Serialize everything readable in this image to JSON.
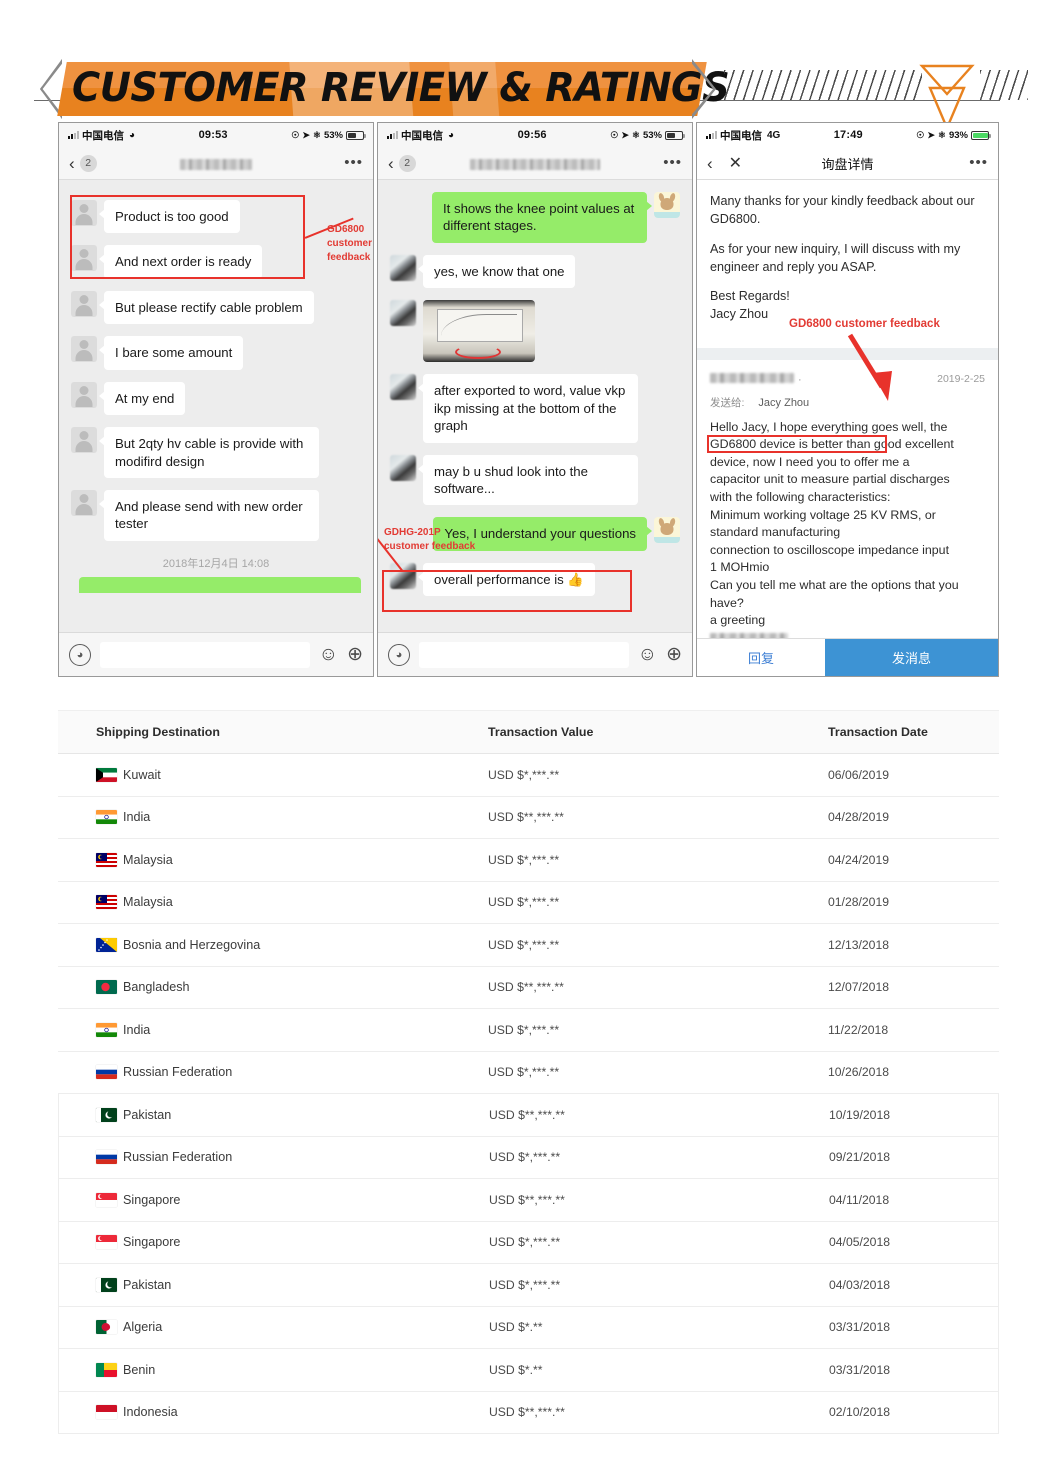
{
  "header": {
    "title": "CUSTOMER REVIEW & RATINGS",
    "accent_color": "#e8821f"
  },
  "phones": [
    {
      "name": "phone-1",
      "status": {
        "carrier": "中国电信",
        "network": "",
        "wifi": "wifi-icon",
        "time": "09:53",
        "battery": "53%"
      },
      "nav": {
        "back": "‹",
        "badge": "2",
        "title_blurred": true,
        "more": "•••"
      },
      "annotation": {
        "label": "GD6800\ncustomer\nfeedback",
        "label_lines": [
          "GD6800",
          "customer",
          "feedback"
        ]
      },
      "messages": [
        {
          "side": "left",
          "type": "text",
          "text": "Product is too good",
          "boxed": true
        },
        {
          "side": "left",
          "type": "text",
          "text": "And next order is ready",
          "boxed": true
        },
        {
          "side": "left",
          "type": "text",
          "text": "But please rectify cable problem"
        },
        {
          "side": "left",
          "type": "text",
          "text": "I bare some amount"
        },
        {
          "side": "left",
          "type": "text",
          "text": "At my end"
        },
        {
          "side": "left",
          "type": "text",
          "text": "But 2qty hv cable is provide with modifird design"
        },
        {
          "side": "left",
          "type": "text",
          "text": "And please send with new order tester"
        }
      ],
      "timestamp": "2018年12月4日 14:08",
      "input": {
        "voice_icon": "voice-icon",
        "placeholder": "",
        "value": "",
        "emoji_icon": "emoji-icon",
        "plus_icon": "plus-icon"
      }
    },
    {
      "name": "phone-2",
      "status": {
        "carrier": "中国电信",
        "network": "",
        "wifi": "wifi-icon",
        "time": "09:56",
        "battery": "53%"
      },
      "nav": {
        "back": "‹",
        "badge": "2",
        "title_blurred": true,
        "more": "•••"
      },
      "annotation": {
        "label_lines": [
          "GDHG-201P",
          "customer feedback"
        ]
      },
      "messages": [
        {
          "side": "right",
          "type": "text",
          "text": "It shows the knee point values at different stages."
        },
        {
          "side": "left",
          "type": "text",
          "text": "yes, we know that one"
        },
        {
          "side": "left",
          "type": "image",
          "text": ""
        },
        {
          "side": "left",
          "type": "text",
          "text": "after exported to word, value vkp ikp missing at the bottom of the graph"
        },
        {
          "side": "left",
          "type": "text",
          "text": "may b u shud look into the software..."
        },
        {
          "side": "right",
          "type": "text",
          "text": "Yes, I understand your questions"
        },
        {
          "side": "left",
          "type": "text",
          "text": "overall performance is 👍",
          "boxed": true
        }
      ],
      "input": {
        "voice_icon": "voice-icon",
        "placeholder": "",
        "value": "",
        "emoji_icon": "emoji-icon",
        "plus_icon": "plus-icon"
      }
    },
    {
      "name": "phone-3",
      "status": {
        "carrier": "中国电信",
        "network": "4G",
        "wifi": "",
        "time": "17:49",
        "battery": "93%"
      },
      "nav": {
        "back": "‹",
        "close": "✕",
        "title": "询盘详情",
        "more": "•••"
      },
      "annotation": {
        "label": "GD6800 customer feedback"
      },
      "mail": {
        "paragraphs": [
          "Many thanks for your kindly feedback about our GD6800.",
          "As for your new inquiry, I will discuss with my engineer and reply you ASAP."
        ],
        "signoff": [
          "Best Regards!",
          "Jacy Zhou"
        ]
      },
      "quote": {
        "sender_blurred": true,
        "date": "2019-2-25",
        "to_label": "发送给:",
        "to_name": "Jacy Zhou",
        "body_lines": [
          "Hello Jacy, I hope everything goes well, the",
          "GD6800 device is better than good",
          " excellent",
          "device, now I need you to offer me a",
          "capacitor unit to measure partial discharges",
          "with the following characteristics:",
          "Minimum working voltage 25 KV RMS, or",
          "standard manufacturing",
          "connection to oscilloscope impedance input",
          "1 MOHmio",
          "Can you tell me what are the options that you",
          "have?",
          "a greeting"
        ],
        "highlighted_text": "GD6800 device is better than good"
      },
      "footer": {
        "reply": "回复",
        "send": "发消息"
      }
    }
  ],
  "table": {
    "columns": [
      "Shipping Destination",
      "Transaction Value",
      "Transaction Date"
    ],
    "rows": [
      {
        "flag": "kuwait-flag",
        "destination": "Kuwait",
        "value": "USD $*,***.**",
        "date": "06/06/2019"
      },
      {
        "flag": "india-flag",
        "destination": "India",
        "value": "USD $**,***.**",
        "date": "04/28/2019"
      },
      {
        "flag": "malaysia-flag",
        "destination": "Malaysia",
        "value": "USD $*,***.**",
        "date": "04/24/2019"
      },
      {
        "flag": "malaysia-flag",
        "destination": "Malaysia",
        "value": "USD $*,***.**",
        "date": "01/28/2019"
      },
      {
        "flag": "bosnia-flag",
        "destination": "Bosnia and Herzegovina",
        "value": "USD $*,***.**",
        "date": "12/13/2018"
      },
      {
        "flag": "bangladesh-flag",
        "destination": "Bangladesh",
        "value": "USD $**,***.**",
        "date": "12/07/2018"
      },
      {
        "flag": "india-flag",
        "destination": "India",
        "value": "USD $*,***.**",
        "date": "11/22/2018"
      },
      {
        "flag": "russia-flag",
        "destination": "Russian Federation",
        "value": "USD $*,***.**",
        "date": "10/26/2018"
      },
      {
        "flag": "pakistan-flag",
        "destination": "Pakistan",
        "value": "USD $**,***.**",
        "date": "10/19/2018"
      },
      {
        "flag": "russia-flag",
        "destination": "Russian Federation",
        "value": "USD $*,***.**",
        "date": "09/21/2018"
      },
      {
        "flag": "singapore-flag",
        "destination": "Singapore",
        "value": "USD $**,***.**",
        "date": "04/11/2018"
      },
      {
        "flag": "singapore-flag",
        "destination": "Singapore",
        "value": "USD $*,***.**",
        "date": "04/05/2018"
      },
      {
        "flag": "pakistan-flag",
        "destination": "Pakistan",
        "value": "USD $*,***.**",
        "date": "04/03/2018"
      },
      {
        "flag": "algeria-flag",
        "destination": "Algeria",
        "value": "USD $*.**",
        "date": "03/31/2018"
      },
      {
        "flag": "benin-flag",
        "destination": "Benin",
        "value": "USD $*.**",
        "date": "03/31/2018"
      },
      {
        "flag": "indonesia-flag",
        "destination": "Indonesia",
        "value": "USD $**,***.**",
        "date": "02/10/2018"
      }
    ]
  }
}
